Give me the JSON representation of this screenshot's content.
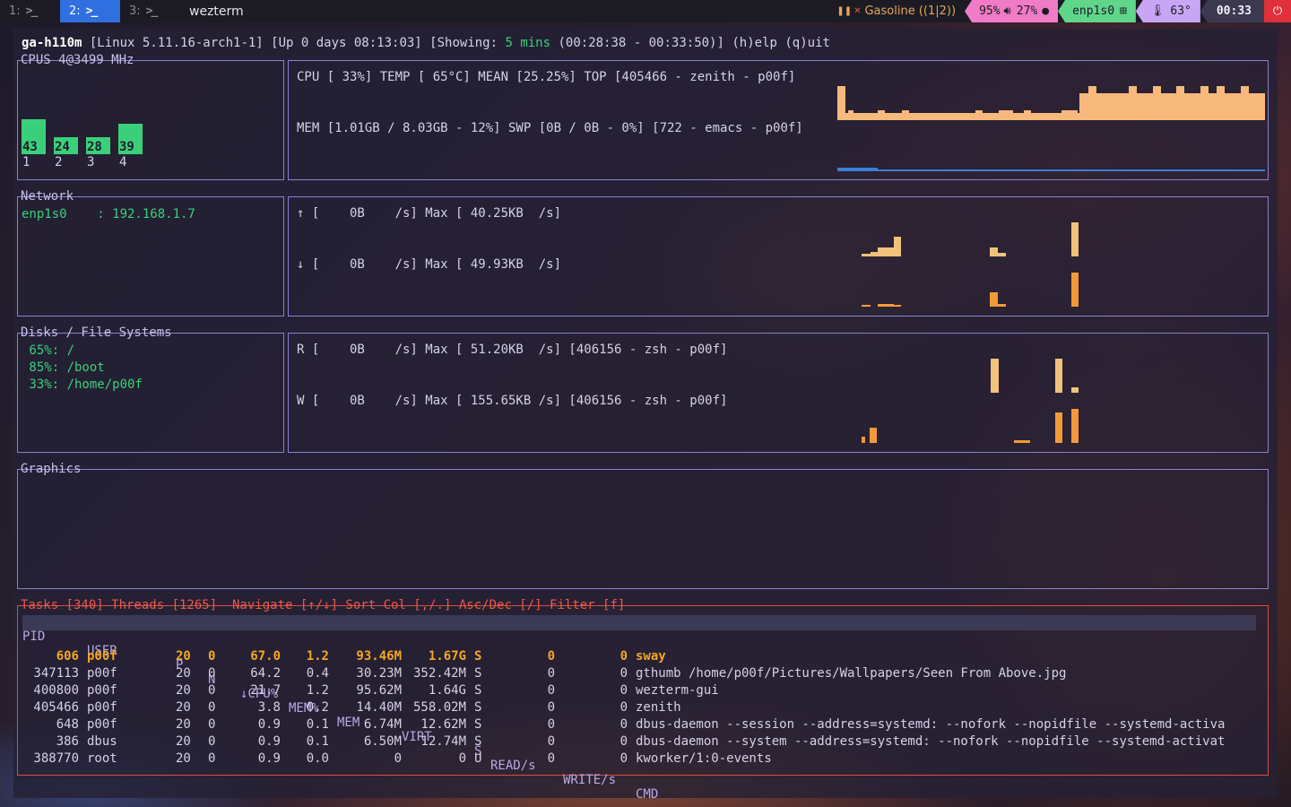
{
  "topbar": {
    "workspaces": [
      {
        "num": "1:",
        "active": false
      },
      {
        "num": "2:",
        "active": true
      },
      {
        "num": "3:",
        "active": false
      }
    ],
    "window_title": "wezterm",
    "media": "Gasoline ((1|2))",
    "volume": "95%",
    "mic": "27%",
    "network": "enp1s0",
    "temperature": "63°",
    "clock": "00:33"
  },
  "header": {
    "host": "ga-h110m",
    "kernel": " [Linux 5.11.16-arch1-1]",
    "uptime": " [Up 0 days 08:13:03]",
    "showing_label": " [Showing: ",
    "showing_value": "5 mins",
    "range": " (00:28:38 - 00:33:50)]",
    "help": " (h)elp (q)uit"
  },
  "cpus": {
    "title": "CPUS 4@3499 MHz",
    "cores": [
      {
        "label": "1",
        "value": "43"
      },
      {
        "label": "2",
        "value": "24"
      },
      {
        "label": "3",
        "value": "28"
      },
      {
        "label": "4",
        "value": "39"
      }
    ],
    "cpu_line": "CPU [ 33%] TEMP [ 65°C] MEAN [25.25%] TOP [405466 - zenith - p00f]",
    "mem_line": "MEM [1.01GB / 8.03GB - 12%] SWP [0B / 0B - 0%] [722 - emacs - p00f]"
  },
  "network": {
    "title": "Network",
    "iface": "enp1s0    : 192.168.1.7",
    "up_line": "↑ [    0B    /s] Max [ 40.25KB  /s]",
    "down_line": "↓ [    0B    /s] Max [ 49.93KB  /s]"
  },
  "disks": {
    "title": "Disks / File Systems",
    "items": [
      " 65%: /",
      " 85%: /boot",
      " 33%: /home/p00f"
    ],
    "read_line": "R [    0B    /s] Max [ 51.20KB  /s] [406156 - zsh - p00f]",
    "write_line": "W [    0B    /s] Max [ 155.65KB /s] [406156 - zsh - p00f]"
  },
  "graphics": {
    "title": "Graphics"
  },
  "tasks": {
    "title": "Tasks [340] Threads [1265]  Navigate [↑/↓] Sort Col [,/.] Asc/Dec [/] Filter [f]",
    "columns": [
      "PID",
      "USER",
      "P",
      "N",
      "↓CPU%",
      "MEM%",
      "MEM",
      "VIRT",
      "S",
      "READ/s",
      "WRITE/s",
      "CMD"
    ],
    "rows": [
      {
        "pid": "606",
        "user": "p00f",
        "p": "20",
        "n": "0",
        "cpu": "67.0",
        "mem_pct": "1.2",
        "mem": "93.46M",
        "virt": "1.67G",
        "s": "S",
        "read": "0",
        "write": "0",
        "cmd": "sway"
      },
      {
        "pid": "347113",
        "user": "p00f",
        "p": "20",
        "n": "0",
        "cpu": "64.2",
        "mem_pct": "0.4",
        "mem": "30.23M",
        "virt": "352.42M",
        "s": "S",
        "read": "0",
        "write": "0",
        "cmd": "gthumb /home/p00f/Pictures/Wallpapers/Seen From Above.jpg"
      },
      {
        "pid": "400800",
        "user": "p00f",
        "p": "20",
        "n": "0",
        "cpu": "21.7",
        "mem_pct": "1.2",
        "mem": "95.62M",
        "virt": "1.64G",
        "s": "S",
        "read": "0",
        "write": "0",
        "cmd": "wezterm-gui"
      },
      {
        "pid": "405466",
        "user": "p00f",
        "p": "20",
        "n": "0",
        "cpu": "3.8",
        "mem_pct": "0.2",
        "mem": "14.40M",
        "virt": "558.02M",
        "s": "S",
        "read": "0",
        "write": "0",
        "cmd": "zenith"
      },
      {
        "pid": "648",
        "user": "p00f",
        "p": "20",
        "n": "0",
        "cpu": "0.9",
        "mem_pct": "0.1",
        "mem": "6.74M",
        "virt": "12.62M",
        "s": "S",
        "read": "0",
        "write": "0",
        "cmd": "dbus-daemon --session --address=systemd: --nofork --nopidfile --systemd-activa"
      },
      {
        "pid": "386",
        "user": "dbus",
        "p": "20",
        "n": "0",
        "cpu": "0.9",
        "mem_pct": "0.1",
        "mem": "6.50M",
        "virt": "12.74M",
        "s": "S",
        "read": "0",
        "write": "0",
        "cmd": "dbus-daemon --system --address=systemd: --nofork --nopidfile --systemd-activat"
      },
      {
        "pid": "388770",
        "user": "root",
        "p": "20",
        "n": "0",
        "cpu": "0.9",
        "mem_pct": "0.0",
        "mem": "0",
        "virt": "0",
        "s": "U",
        "read": "0",
        "write": "0",
        "cmd": "kworker/1:0-events"
      }
    ]
  }
}
